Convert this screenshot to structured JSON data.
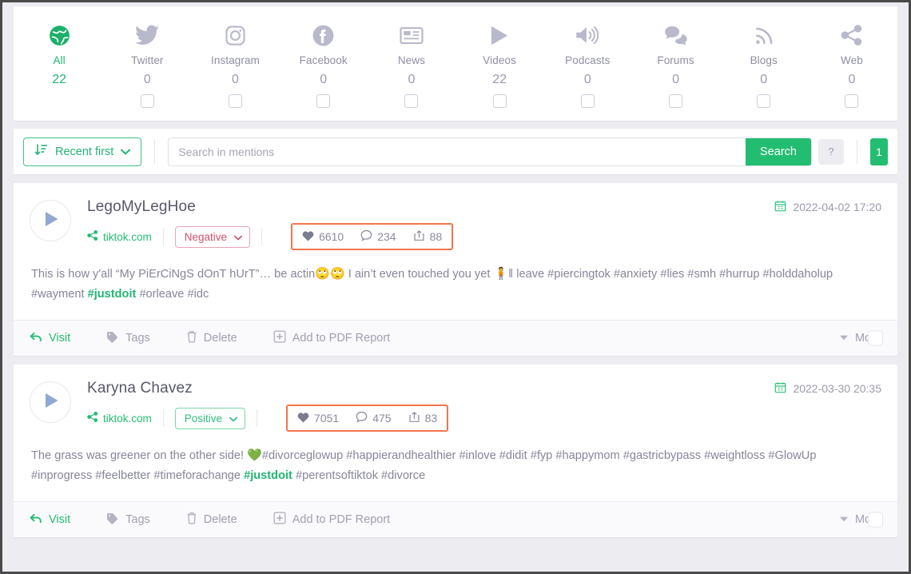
{
  "sources": {
    "items": [
      {
        "label": "All",
        "count": "22",
        "icon": "globe-icon",
        "active": true,
        "checkbox": false
      },
      {
        "label": "Twitter",
        "count": "0",
        "icon": "twitter-icon",
        "active": false,
        "checkbox": true
      },
      {
        "label": "Instagram",
        "count": "0",
        "icon": "instagram-icon",
        "active": false,
        "checkbox": true
      },
      {
        "label": "Facebook",
        "count": "0",
        "icon": "facebook-icon",
        "active": false,
        "checkbox": true
      },
      {
        "label": "News",
        "count": "0",
        "icon": "news-icon",
        "active": false,
        "checkbox": true
      },
      {
        "label": "Videos",
        "count": "22",
        "icon": "video-icon",
        "active": false,
        "checkbox": true
      },
      {
        "label": "Podcasts",
        "count": "0",
        "icon": "podcast-icon",
        "active": false,
        "checkbox": true
      },
      {
        "label": "Forums",
        "count": "0",
        "icon": "forums-icon",
        "active": false,
        "checkbox": true
      },
      {
        "label": "Blogs",
        "count": "0",
        "icon": "rss-icon",
        "active": false,
        "checkbox": true
      },
      {
        "label": "Web",
        "count": "0",
        "icon": "share-icon",
        "active": false,
        "checkbox": true
      }
    ]
  },
  "toolbar": {
    "sort_label": "Recent first",
    "search_placeholder": "Search in mentions",
    "search_value": "",
    "search_button": "Search",
    "help_label": "?",
    "page_badge": "1"
  },
  "colors": {
    "accent_green": "#23bd71",
    "highlight_orange": "#f4744a",
    "negative_red": "#d3506e",
    "positive_green": "#33bb7e",
    "muted_text": "#8e8ea3"
  },
  "mentions": [
    {
      "author": "LegoMyLegHoe",
      "domain": "tiktok.com",
      "sentiment": "Negative",
      "sentiment_type": "negative",
      "date": "2022-04-02 17:20",
      "stats": {
        "likes": "6610",
        "comments": "234",
        "shares": "88"
      },
      "text_parts": [
        {
          "t": "This is how y'all “My PiErCiNgS dOnT hUrT”… be actin",
          "hl": false
        },
        {
          "t": "🙄🙄",
          "hl": false,
          "emoji": true
        },
        {
          "t": " I ain’t even touched you yet ",
          "hl": false
        },
        {
          "t": "🧍",
          "hl": false,
          "emoji": true
        },
        {
          "t": "‖ leave #piercingtok #anxiety #lies #smh #hurrup #holddaholup #wayment ",
          "hl": false
        },
        {
          "t": "#justdoit",
          "hl": true
        },
        {
          "t": " #orleave #idc",
          "hl": false
        }
      ],
      "actions": [
        "Visit",
        "Tags",
        "Delete",
        "Add to PDF Report",
        "More"
      ]
    },
    {
      "author": "Karyna Chavez",
      "domain": "tiktok.com",
      "sentiment": "Positive",
      "sentiment_type": "positive",
      "date": "2022-03-30 20:35",
      "stats": {
        "likes": "7051",
        "comments": "475",
        "shares": "83"
      },
      "text_parts": [
        {
          "t": "The grass was greener on the other side! ",
          "hl": false
        },
        {
          "t": "💚",
          "hl": false,
          "emoji": true
        },
        {
          "t": "#divorceglowup #happierandhealthier #inlove #didit #fyp #happymom #gastricbypass #weightloss #GlowUp #inprogress #feelbetter #timeforachange ",
          "hl": false
        },
        {
          "t": "#justdoit",
          "hl": true
        },
        {
          "t": " #perentsoftiktok #divorce",
          "hl": false
        }
      ],
      "actions": [
        "Visit",
        "Tags",
        "Delete",
        "Add to PDF Report",
        "More"
      ]
    }
  ]
}
